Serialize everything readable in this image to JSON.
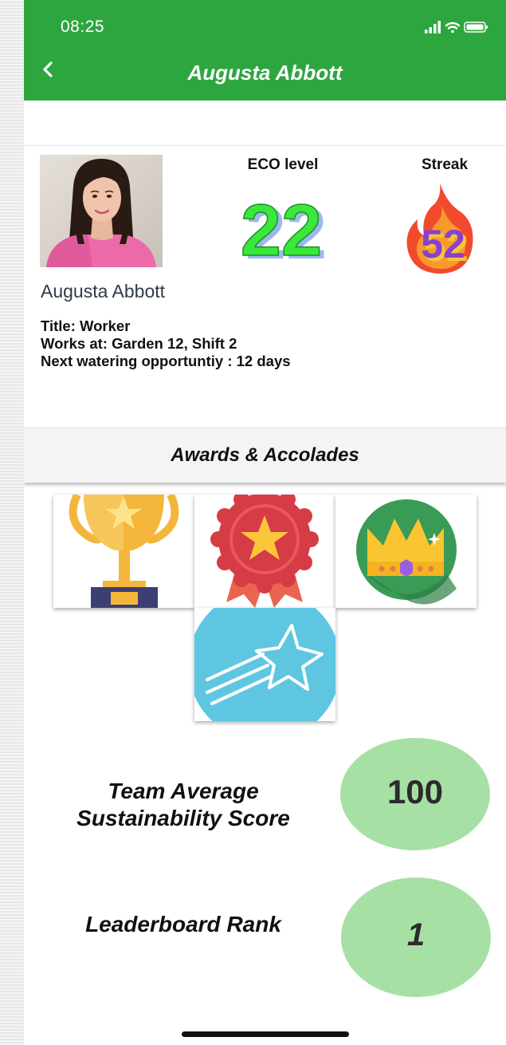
{
  "status_bar": {
    "time": "08:25"
  },
  "nav": {
    "back_icon": "chevron-left-icon",
    "title": "Augusta Abbott"
  },
  "profile": {
    "name": "Augusta Abbott",
    "eco_level_label": "ECO level",
    "eco_level_value": "22",
    "streak_label": "Streak",
    "streak_value": "52",
    "details": [
      "Title: Worker",
      "Works at: Garden 12, Shift 2",
      "Next watering opportuntiy : 12 days"
    ]
  },
  "awards": {
    "title": "Awards & Accolades",
    "items": [
      "trophy-icon",
      "rosette-icon",
      "crown-icon",
      "shooting-star-icon"
    ]
  },
  "stats": {
    "score_label_line1": "Team Average",
    "score_label_line2": "Sustainability  Score",
    "score_value": "100",
    "rank_label": "Leaderboard Rank",
    "rank_value": "1"
  },
  "colors": {
    "header_green": "#2ea640",
    "bubble_green": "#a6e0a4",
    "eco_value_green": "#39e83b",
    "streak_purple": "#8a3fd0"
  }
}
